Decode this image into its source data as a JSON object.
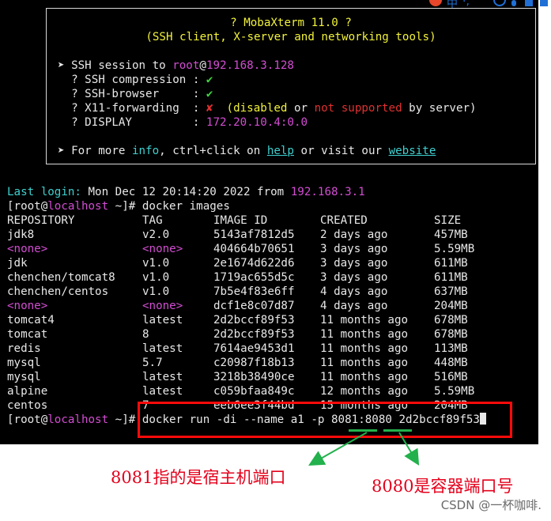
{
  "banner": {
    "title": "? MobaXterm 11.0 ?",
    "subtitle": "(SSH client, X-server and networking tools)",
    "session_prefix": "➤ SSH session to ",
    "session_user": "root",
    "session_at": "@",
    "session_host": "192.168.3.128",
    "compression_label": "  ? SSH compression : ",
    "compression_status": "✔",
    "browser_label": "  ? SSH-browser     : ",
    "browser_status": "✔",
    "x11_label": "  ? X11-forwarding  : ",
    "x11_status": "✘",
    "x11_open": "  (disabled ",
    "x11_or": "or ",
    "x11_not": "not supported",
    "x11_by": " by server)",
    "display_label": "  ? DISPLAY         : ",
    "display_value": "172.20.10.4:0.0",
    "more_prefix": "➤ For more ",
    "more_info": "info",
    "more_mid": ", ctrl+click on ",
    "more_help": "help",
    "more_or": " or visit our ",
    "more_website": "website"
  },
  "login": {
    "label": "Last login:",
    "date": " Mon Dec 12 20:14:20 2022 from ",
    "host": "192.168.3.1"
  },
  "prompt": {
    "open": "[root@",
    "host": "localhost",
    "close": " ~]# ",
    "command": "docker images"
  },
  "table": {
    "headers": [
      "REPOSITORY",
      "TAG",
      "IMAGE ID",
      "CREATED",
      "SIZE"
    ],
    "rows": [
      [
        "jdk8",
        "v2.0",
        "5143af7812d5",
        "2 days ago",
        "457MB"
      ],
      [
        "<none>",
        "<none>",
        "404664b70651",
        "3 days ago",
        "5.59MB"
      ],
      [
        "jdk",
        "v1.0",
        "2e1674d622d6",
        "3 days ago",
        "611MB"
      ],
      [
        "chenchen/tomcat8",
        "v1.0",
        "1719ac655d5c",
        "3 days ago",
        "611MB"
      ],
      [
        "chenchen/centos",
        "v1.0",
        "7b5e4f83e6ff",
        "4 days ago",
        "637MB"
      ],
      [
        "<none>",
        "<none>",
        "dcf1e8c07d87",
        "4 days ago",
        "204MB"
      ],
      [
        "tomcat4",
        "latest",
        "2d2bccf89f53",
        "11 months ago",
        "678MB"
      ],
      [
        "tomcat",
        "8",
        "2d2bccf89f53",
        "11 months ago",
        "678MB"
      ],
      [
        "redis",
        "latest",
        "7614ae9453d1",
        "11 months ago",
        "113MB"
      ],
      [
        "mysql",
        "5.7",
        "c20987f18b13",
        "11 months ago",
        "448MB"
      ],
      [
        "mysql",
        "latest",
        "3218b38490ce",
        "11 months ago",
        "516MB"
      ],
      [
        "alpine",
        "latest",
        "c059bfaa849c",
        "12 months ago",
        "5.59MB"
      ],
      [
        "centos",
        "7",
        "eeb6ee3f44bd",
        "15 months ago",
        "204MB"
      ]
    ]
  },
  "run_command": {
    "prefix": "docker run -di --name a1 -p ",
    "host_port": "8081",
    "colon": ":",
    "container_port": "8080",
    "image": " 2d2bccf89f53"
  },
  "annotations": {
    "host_port_note": "8081指的是宿主机端口",
    "container_port_note": "8080是容器端口号"
  },
  "watermark": "CSDN @一杯咖啡.",
  "toolbar": {
    "lang_label": "中",
    "sep": "·,"
  },
  "colors": {
    "annotation_red": "#e4001b",
    "box_red": "#ff0a0a",
    "arrow_green": "#22b14c",
    "term_magenta": "#d24dd2",
    "term_yellow": "#f2f23a",
    "term_cyan": "#3fd0d0"
  }
}
